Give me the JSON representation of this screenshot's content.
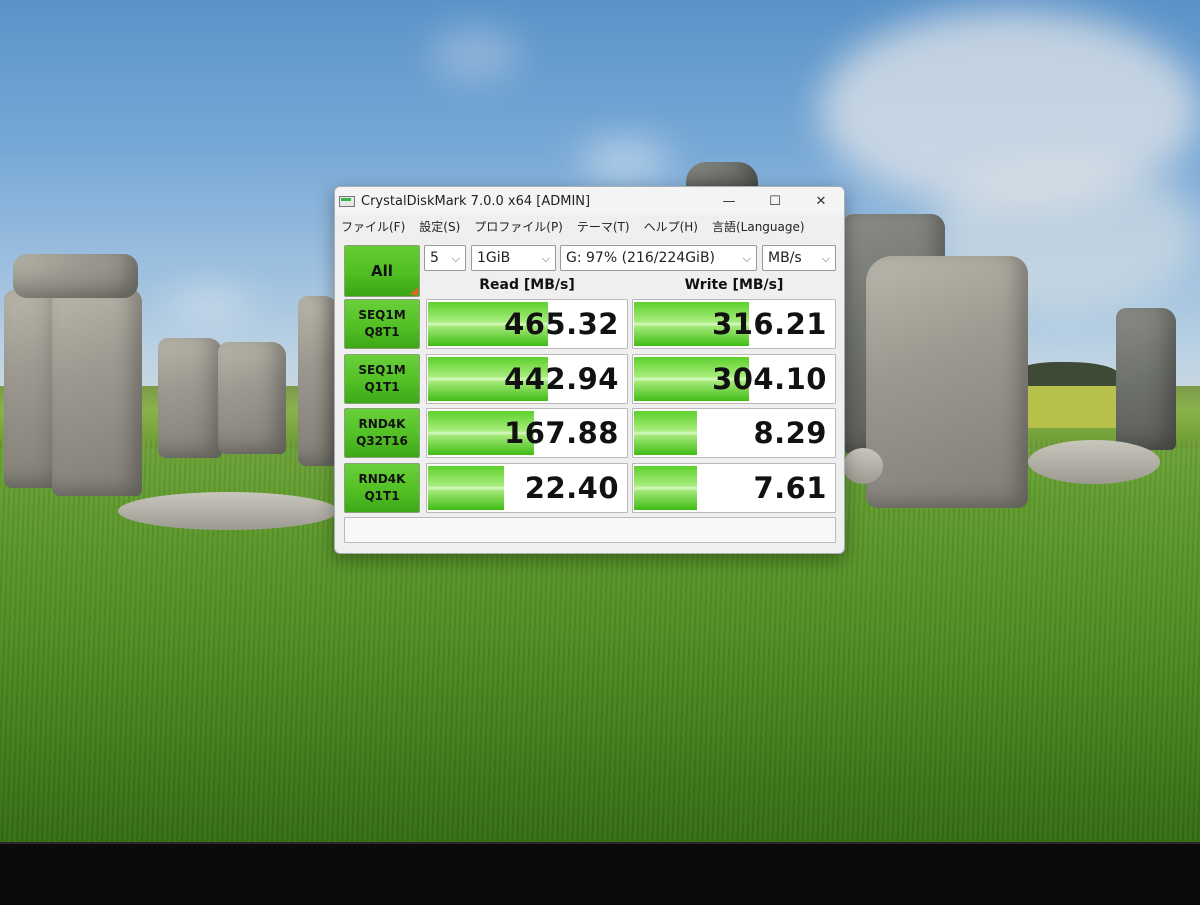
{
  "window": {
    "title": "CrystalDiskMark 7.0.0 x64 [ADMIN]",
    "controls": {
      "minimize": "—",
      "maximize": "☐",
      "close": "✕"
    }
  },
  "menu": [
    "ファイル(F)",
    "設定(S)",
    "プロファイル(P)",
    "テーマ(T)",
    "ヘルプ(H)",
    "言語(Language)"
  ],
  "toolbar": {
    "all_label": "All",
    "test_count": "5",
    "test_size": "1GiB",
    "drive": "G: 97% (216/224GiB)",
    "unit": "MB/s"
  },
  "headers": {
    "read": "Read [MB/s]",
    "write": "Write [MB/s]"
  },
  "results": [
    {
      "line1": "SEQ1M",
      "line2": "Q8T1",
      "read": "465.32",
      "write": "316.21",
      "read_level": 0.6,
      "write_level": 0.57
    },
    {
      "line1": "SEQ1M",
      "line2": "Q1T1",
      "read": "442.94",
      "write": "304.10",
      "read_level": 0.6,
      "write_level": 0.57
    },
    {
      "line1": "RND4K",
      "line2": "Q32T16",
      "read": "167.88",
      "write": "8.29",
      "read_level": 0.53,
      "write_level": 0.31
    },
    {
      "line1": "RND4K",
      "line2": "Q1T1",
      "read": "22.40",
      "write": "7.61",
      "read_level": 0.38,
      "write_level": 0.31
    }
  ],
  "comment": "",
  "colors": {
    "accent_green": "#4fbf22",
    "corner_orange": "#e8632a"
  }
}
